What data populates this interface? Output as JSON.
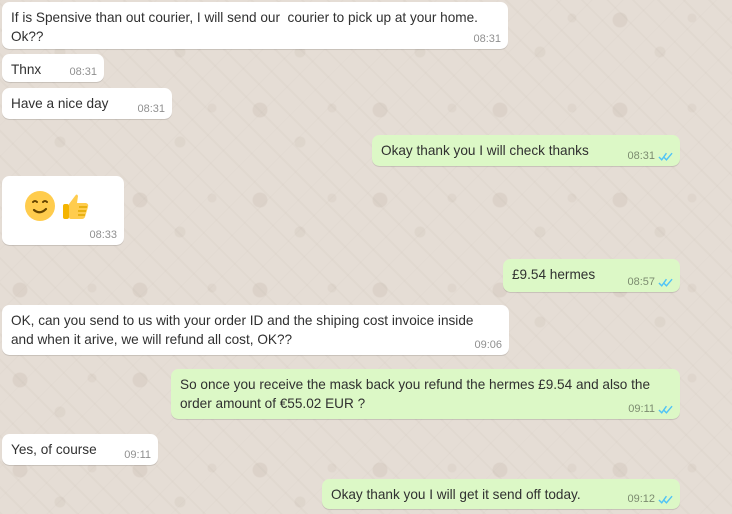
{
  "theme": {
    "incoming_bg": "#ffffff",
    "outgoing_bg": "#dcf8c6",
    "wallpaper": "#e5ddd5",
    "tick_blue": "#4fc3f7",
    "emoji_yellow": "#ffcc4d",
    "emoji_dark": "#664500"
  },
  "messages": [
    {
      "id": "m1",
      "direction": "incoming",
      "text": "If is Spensive than out courier, I will send our  courier to pick up at your home.\nOk??",
      "time": "08:31"
    },
    {
      "id": "m2",
      "direction": "incoming",
      "text": "Thnx",
      "time": "08:31"
    },
    {
      "id": "m3",
      "direction": "incoming",
      "text": "Have a nice day",
      "time": "08:31"
    },
    {
      "id": "m4",
      "direction": "outgoing",
      "text": "Okay thank you I will check thanks",
      "time": "08:31",
      "status": "read"
    },
    {
      "id": "m5",
      "direction": "incoming",
      "text": "",
      "emojis": [
        "smirking-face",
        "thumbs-up"
      ],
      "time": "08:33"
    },
    {
      "id": "m6",
      "direction": "outgoing",
      "text": "£9.54 hermes",
      "time": "08:57",
      "status": "read"
    },
    {
      "id": "m7",
      "direction": "incoming",
      "text": "OK, can you send to us with your order ID and the shiping cost invoice inside\nand when it arive, we will refund all cost, OK??",
      "time": "09:06"
    },
    {
      "id": "m8",
      "direction": "outgoing",
      "text": "So once you receive the mask back you refund the hermes £9.54 and also the\norder amount of €55.02 EUR ?",
      "time": "09:11",
      "status": "read"
    },
    {
      "id": "m9",
      "direction": "incoming",
      "text": "Yes, of course",
      "time": "09:11"
    },
    {
      "id": "m10",
      "direction": "outgoing",
      "text": "Okay thank you I will get it send off today.",
      "time": "09:12",
      "status": "read"
    }
  ]
}
